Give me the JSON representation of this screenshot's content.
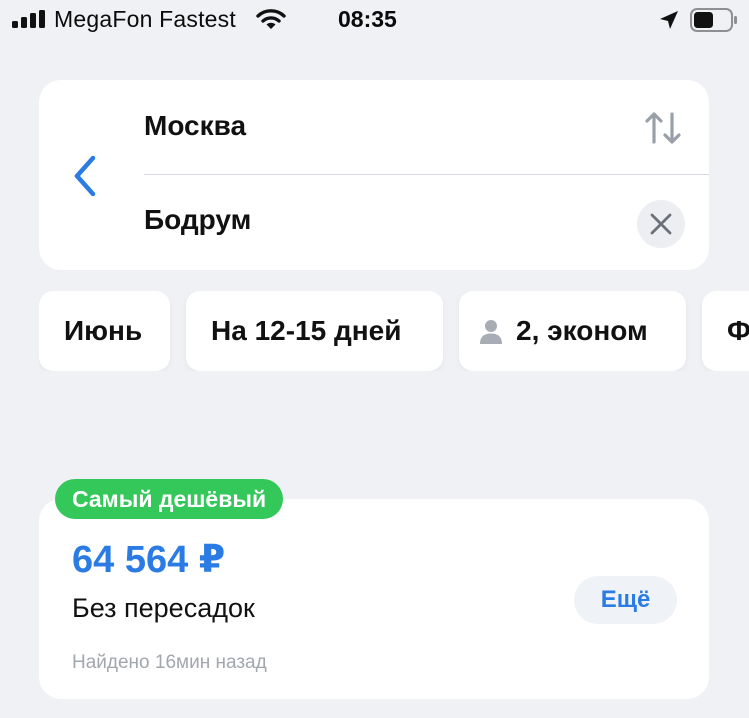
{
  "status_bar": {
    "carrier": "MegaFon Fastest",
    "time": "08:35",
    "icons": [
      "signal-bars-icon",
      "wifi-icon",
      "location-arrow-icon",
      "battery-icon"
    ]
  },
  "search": {
    "from": "Москва",
    "to": "Бодрум",
    "icons": {
      "back": "chevron-left-icon",
      "swap": "swap-arrows-icon",
      "clear": "close-icon"
    }
  },
  "filters": {
    "month": "Июнь",
    "duration": "На 12-15 дней",
    "passengers": "2, эконом",
    "more": "Ф",
    "passenger_icon": "person-icon"
  },
  "offer": {
    "badge": "Самый дешёвый",
    "price": "64 564 ₽",
    "transfers": "Без пересадок",
    "found": "Найдено 16мин назад",
    "more_button": "Ещё"
  },
  "colors": {
    "background": "#eff1f5",
    "accent": "#2b7be4",
    "badge": "#34c759",
    "secondary_text": "#a2a6ad"
  }
}
